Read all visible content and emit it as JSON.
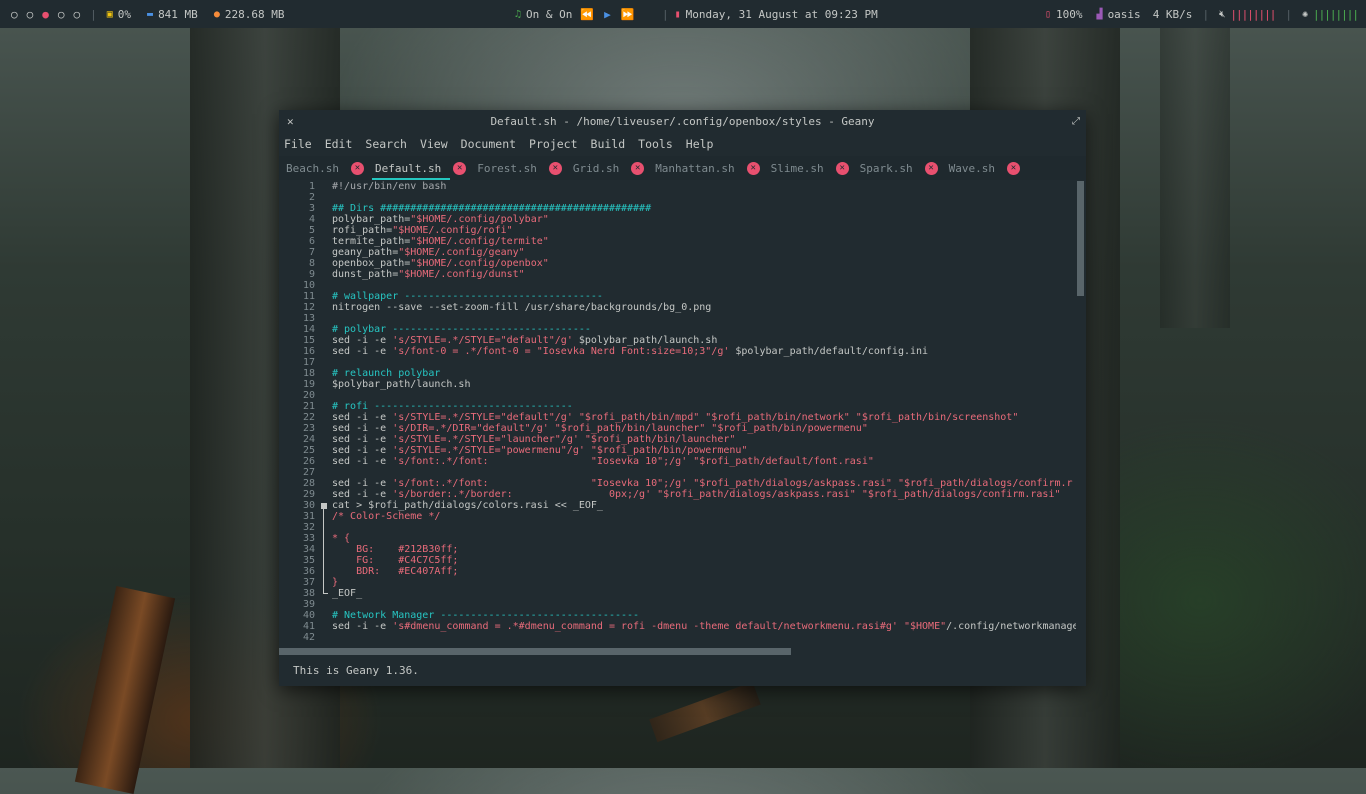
{
  "topbar": {
    "workspaces": [
      "○",
      "○",
      "●",
      "○",
      "○"
    ],
    "cpu": "0%",
    "memory": "841 MB",
    "disk": "228.68 MB",
    "music_title": "On & On",
    "datetime": "Monday, 31 August at 09:23 PM",
    "battery": "100%",
    "network_name": "oasis",
    "network_speed": "4 KB/s",
    "volume_bars": "||||||||",
    "brightness_bars": "||||||||"
  },
  "window": {
    "title": "Default.sh - /home/liveuser/.config/openbox/styles - Geany",
    "menu": [
      "File",
      "Edit",
      "Search",
      "View",
      "Document",
      "Project",
      "Build",
      "Tools",
      "Help"
    ],
    "tabs": [
      {
        "label": "Beach.sh"
      },
      {
        "label": "Default.sh"
      },
      {
        "label": "Forest.sh"
      },
      {
        "label": "Grid.sh"
      },
      {
        "label": "Manhattan.sh"
      },
      {
        "label": "Slime.sh"
      },
      {
        "label": "Spark.sh"
      },
      {
        "label": "Wave.sh"
      }
    ],
    "status": "This is Geany 1.36."
  },
  "code_lines": [
    {
      "n": "1",
      "parts": [
        [
          "c-sh",
          "#!/usr/bin/env bash"
        ]
      ]
    },
    {
      "n": "2",
      "parts": []
    },
    {
      "n": "3",
      "parts": [
        [
          "c-com",
          "## Dirs #############################################"
        ]
      ]
    },
    {
      "n": "4",
      "parts": [
        [
          "c-txt",
          "polybar_path="
        ],
        [
          "c-str",
          "\"$HOME/.config/polybar\""
        ]
      ]
    },
    {
      "n": "5",
      "parts": [
        [
          "c-txt",
          "rofi_path="
        ],
        [
          "c-str",
          "\"$HOME/.config/rofi\""
        ]
      ]
    },
    {
      "n": "6",
      "parts": [
        [
          "c-txt",
          "termite_path="
        ],
        [
          "c-str",
          "\"$HOME/.config/termite\""
        ]
      ]
    },
    {
      "n": "7",
      "parts": [
        [
          "c-txt",
          "geany_path="
        ],
        [
          "c-str",
          "\"$HOME/.config/geany\""
        ]
      ]
    },
    {
      "n": "8",
      "parts": [
        [
          "c-txt",
          "openbox_path="
        ],
        [
          "c-str",
          "\"$HOME/.config/openbox\""
        ]
      ]
    },
    {
      "n": "9",
      "parts": [
        [
          "c-txt",
          "dunst_path="
        ],
        [
          "c-str",
          "\"$HOME/.config/dunst\""
        ]
      ]
    },
    {
      "n": "10",
      "parts": []
    },
    {
      "n": "11",
      "parts": [
        [
          "c-com",
          "# wallpaper ---------------------------------"
        ]
      ]
    },
    {
      "n": "12",
      "parts": [
        [
          "c-txt",
          "nitrogen --save --set-zoom-fill /usr/share/backgrounds/bg_0.png"
        ]
      ]
    },
    {
      "n": "13",
      "parts": []
    },
    {
      "n": "14",
      "parts": [
        [
          "c-com",
          "# polybar ---------------------------------"
        ]
      ]
    },
    {
      "n": "15",
      "parts": [
        [
          "c-txt",
          "sed -i -e "
        ],
        [
          "c-str",
          "'s/STYLE=.*/STYLE=\"default\"/g'"
        ],
        [
          "c-txt",
          " $polybar_path/launch.sh"
        ]
      ]
    },
    {
      "n": "16",
      "parts": [
        [
          "c-txt",
          "sed -i -e "
        ],
        [
          "c-str",
          "'s/font-0 = .*/font-0 = \"Iosevka Nerd Font:size=10;3\"/g'"
        ],
        [
          "c-txt",
          " $polybar_path/default/config.ini"
        ]
      ]
    },
    {
      "n": "17",
      "parts": []
    },
    {
      "n": "18",
      "parts": [
        [
          "c-com",
          "# relaunch polybar"
        ]
      ]
    },
    {
      "n": "19",
      "parts": [
        [
          "c-txt",
          "$polybar_path/launch.sh"
        ]
      ]
    },
    {
      "n": "20",
      "parts": []
    },
    {
      "n": "21",
      "parts": [
        [
          "c-com",
          "# rofi ---------------------------------"
        ]
      ]
    },
    {
      "n": "22",
      "parts": [
        [
          "c-txt",
          "sed -i -e "
        ],
        [
          "c-str",
          "'s/STYLE=.*/STYLE=\"default\"/g' \"$rofi_path/bin/mpd\" \"$rofi_path/bin/network\" \"$rofi_path/bin/screenshot\""
        ]
      ]
    },
    {
      "n": "23",
      "parts": [
        [
          "c-txt",
          "sed -i -e "
        ],
        [
          "c-str",
          "'s/DIR=.*/DIR=\"default\"/g' \"$rofi_path/bin/launcher\" \"$rofi_path/bin/powermenu\""
        ]
      ]
    },
    {
      "n": "24",
      "parts": [
        [
          "c-txt",
          "sed -i -e "
        ],
        [
          "c-str",
          "'s/STYLE=.*/STYLE=\"launcher\"/g' \"$rofi_path/bin/launcher\""
        ]
      ]
    },
    {
      "n": "25",
      "parts": [
        [
          "c-txt",
          "sed -i -e "
        ],
        [
          "c-str",
          "'s/STYLE=.*/STYLE=\"powermenu\"/g' \"$rofi_path/bin/powermenu\""
        ]
      ]
    },
    {
      "n": "26",
      "parts": [
        [
          "c-txt",
          "sed -i -e "
        ],
        [
          "c-str",
          "'s/font:.*/font:                 \"Iosevka 10\";/g' \"$rofi_path/default/font.rasi\""
        ]
      ]
    },
    {
      "n": "27",
      "parts": []
    },
    {
      "n": "28",
      "parts": [
        [
          "c-txt",
          "sed -i -e "
        ],
        [
          "c-str",
          "'s/font:.*/font:                 \"Iosevka 10\";/g' \"$rofi_path/dialogs/askpass.rasi\" \"$rofi_path/dialogs/confirm.r"
        ]
      ]
    },
    {
      "n": "29",
      "parts": [
        [
          "c-txt",
          "sed -i -e "
        ],
        [
          "c-str",
          "'s/border:.*/border:                0px;/g' \"$rofi_path/dialogs/askpass.rasi\" \"$rofi_path/dialogs/confirm.rasi\""
        ]
      ]
    },
    {
      "n": "30",
      "parts": [
        [
          "c-txt",
          "cat > $rofi_path/dialogs/colors.rasi << _EOF_"
        ]
      ]
    },
    {
      "n": "31",
      "parts": [
        [
          "c-str",
          "/* Color-Scheme */"
        ]
      ]
    },
    {
      "n": "32",
      "parts": []
    },
    {
      "n": "33",
      "parts": [
        [
          "c-str",
          "* {"
        ]
      ]
    },
    {
      "n": "34",
      "parts": [
        [
          "c-str",
          "    BG:    #212B30ff;"
        ]
      ]
    },
    {
      "n": "35",
      "parts": [
        [
          "c-str",
          "    FG:    #C4C7C5ff;"
        ]
      ]
    },
    {
      "n": "36",
      "parts": [
        [
          "c-str",
          "    BDR:   #EC407Aff;"
        ]
      ]
    },
    {
      "n": "37",
      "parts": [
        [
          "c-str",
          "}"
        ]
      ]
    },
    {
      "n": "38",
      "parts": [
        [
          "c-txt",
          "_EOF_"
        ]
      ]
    },
    {
      "n": "39",
      "parts": []
    },
    {
      "n": "40",
      "parts": [
        [
          "c-com",
          "# Network Manager ---------------------------------"
        ]
      ]
    },
    {
      "n": "41",
      "parts": [
        [
          "c-txt",
          "sed -i -e "
        ],
        [
          "c-str",
          "'s#dmenu_command = .*#dmenu_command = rofi -dmenu -theme default/networkmenu.rasi#g' \"$HOME\""
        ],
        [
          "c-txt",
          "/.config/networkmanager"
        ]
      ]
    },
    {
      "n": "42",
      "parts": []
    }
  ],
  "colors": {
    "accent": "#25c7c0",
    "pink": "#e8506f",
    "bg": "#212b30",
    "fg": "#c4c7c5"
  }
}
